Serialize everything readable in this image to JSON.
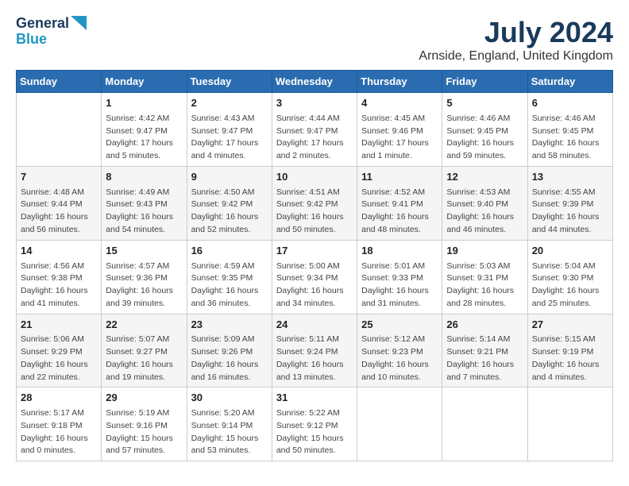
{
  "logo": {
    "line1": "General",
    "line2": "Blue"
  },
  "title": "July 2024",
  "location": "Arnside, England, United Kingdom",
  "days_of_week": [
    "Sunday",
    "Monday",
    "Tuesday",
    "Wednesday",
    "Thursday",
    "Friday",
    "Saturday"
  ],
  "weeks": [
    [
      {
        "day": "",
        "info": ""
      },
      {
        "day": "1",
        "info": "Sunrise: 4:42 AM\nSunset: 9:47 PM\nDaylight: 17 hours\nand 5 minutes."
      },
      {
        "day": "2",
        "info": "Sunrise: 4:43 AM\nSunset: 9:47 PM\nDaylight: 17 hours\nand 4 minutes."
      },
      {
        "day": "3",
        "info": "Sunrise: 4:44 AM\nSunset: 9:47 PM\nDaylight: 17 hours\nand 2 minutes."
      },
      {
        "day": "4",
        "info": "Sunrise: 4:45 AM\nSunset: 9:46 PM\nDaylight: 17 hours\nand 1 minute."
      },
      {
        "day": "5",
        "info": "Sunrise: 4:46 AM\nSunset: 9:45 PM\nDaylight: 16 hours\nand 59 minutes."
      },
      {
        "day": "6",
        "info": "Sunrise: 4:46 AM\nSunset: 9:45 PM\nDaylight: 16 hours\nand 58 minutes."
      }
    ],
    [
      {
        "day": "7",
        "info": "Sunrise: 4:48 AM\nSunset: 9:44 PM\nDaylight: 16 hours\nand 56 minutes."
      },
      {
        "day": "8",
        "info": "Sunrise: 4:49 AM\nSunset: 9:43 PM\nDaylight: 16 hours\nand 54 minutes."
      },
      {
        "day": "9",
        "info": "Sunrise: 4:50 AM\nSunset: 9:42 PM\nDaylight: 16 hours\nand 52 minutes."
      },
      {
        "day": "10",
        "info": "Sunrise: 4:51 AM\nSunset: 9:42 PM\nDaylight: 16 hours\nand 50 minutes."
      },
      {
        "day": "11",
        "info": "Sunrise: 4:52 AM\nSunset: 9:41 PM\nDaylight: 16 hours\nand 48 minutes."
      },
      {
        "day": "12",
        "info": "Sunrise: 4:53 AM\nSunset: 9:40 PM\nDaylight: 16 hours\nand 46 minutes."
      },
      {
        "day": "13",
        "info": "Sunrise: 4:55 AM\nSunset: 9:39 PM\nDaylight: 16 hours\nand 44 minutes."
      }
    ],
    [
      {
        "day": "14",
        "info": "Sunrise: 4:56 AM\nSunset: 9:38 PM\nDaylight: 16 hours\nand 41 minutes."
      },
      {
        "day": "15",
        "info": "Sunrise: 4:57 AM\nSunset: 9:36 PM\nDaylight: 16 hours\nand 39 minutes."
      },
      {
        "day": "16",
        "info": "Sunrise: 4:59 AM\nSunset: 9:35 PM\nDaylight: 16 hours\nand 36 minutes."
      },
      {
        "day": "17",
        "info": "Sunrise: 5:00 AM\nSunset: 9:34 PM\nDaylight: 16 hours\nand 34 minutes."
      },
      {
        "day": "18",
        "info": "Sunrise: 5:01 AM\nSunset: 9:33 PM\nDaylight: 16 hours\nand 31 minutes."
      },
      {
        "day": "19",
        "info": "Sunrise: 5:03 AM\nSunset: 9:31 PM\nDaylight: 16 hours\nand 28 minutes."
      },
      {
        "day": "20",
        "info": "Sunrise: 5:04 AM\nSunset: 9:30 PM\nDaylight: 16 hours\nand 25 minutes."
      }
    ],
    [
      {
        "day": "21",
        "info": "Sunrise: 5:06 AM\nSunset: 9:29 PM\nDaylight: 16 hours\nand 22 minutes."
      },
      {
        "day": "22",
        "info": "Sunrise: 5:07 AM\nSunset: 9:27 PM\nDaylight: 16 hours\nand 19 minutes."
      },
      {
        "day": "23",
        "info": "Sunrise: 5:09 AM\nSunset: 9:26 PM\nDaylight: 16 hours\nand 16 minutes."
      },
      {
        "day": "24",
        "info": "Sunrise: 5:11 AM\nSunset: 9:24 PM\nDaylight: 16 hours\nand 13 minutes."
      },
      {
        "day": "25",
        "info": "Sunrise: 5:12 AM\nSunset: 9:23 PM\nDaylight: 16 hours\nand 10 minutes."
      },
      {
        "day": "26",
        "info": "Sunrise: 5:14 AM\nSunset: 9:21 PM\nDaylight: 16 hours\nand 7 minutes."
      },
      {
        "day": "27",
        "info": "Sunrise: 5:15 AM\nSunset: 9:19 PM\nDaylight: 16 hours\nand 4 minutes."
      }
    ],
    [
      {
        "day": "28",
        "info": "Sunrise: 5:17 AM\nSunset: 9:18 PM\nDaylight: 16 hours\nand 0 minutes."
      },
      {
        "day": "29",
        "info": "Sunrise: 5:19 AM\nSunset: 9:16 PM\nDaylight: 15 hours\nand 57 minutes."
      },
      {
        "day": "30",
        "info": "Sunrise: 5:20 AM\nSunset: 9:14 PM\nDaylight: 15 hours\nand 53 minutes."
      },
      {
        "day": "31",
        "info": "Sunrise: 5:22 AM\nSunset: 9:12 PM\nDaylight: 15 hours\nand 50 minutes."
      },
      {
        "day": "",
        "info": ""
      },
      {
        "day": "",
        "info": ""
      },
      {
        "day": "",
        "info": ""
      }
    ]
  ]
}
